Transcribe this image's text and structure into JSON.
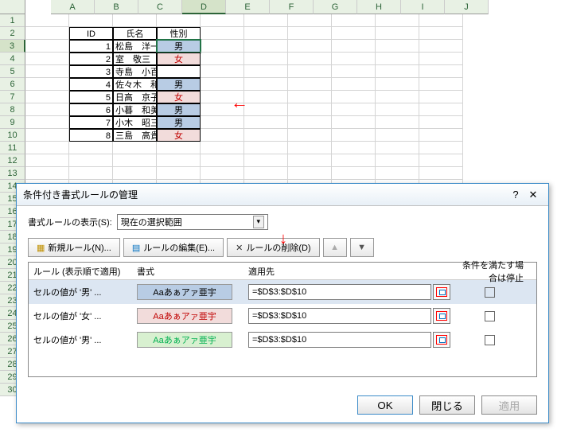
{
  "columns": [
    "A",
    "B",
    "C",
    "D",
    "E",
    "F",
    "G",
    "H",
    "I",
    "J"
  ],
  "table": {
    "headers": {
      "id": "ID",
      "name": "氏名",
      "sex": "性別"
    },
    "rows": [
      {
        "id": "1",
        "name": "松島　洋一朗",
        "sex": "男",
        "cls": "blue-bg"
      },
      {
        "id": "2",
        "name": "室　敬三",
        "sex": "女",
        "cls": "pink-bg"
      },
      {
        "id": "3",
        "name": "寺島　小百合",
        "sex": "",
        "cls": ""
      },
      {
        "id": "4",
        "name": "佐々木　和男",
        "sex": "男",
        "cls": "blue-bg"
      },
      {
        "id": "5",
        "name": "日高　京子",
        "sex": "女",
        "cls": "pink-bg"
      },
      {
        "id": "6",
        "name": "小暮　和美",
        "sex": "男",
        "cls": "blue-bg"
      },
      {
        "id": "7",
        "name": "小木　昭三",
        "sex": "男",
        "cls": "blue-bg"
      },
      {
        "id": "8",
        "name": "三島　高貴",
        "sex": "女",
        "cls": "pink-bg"
      }
    ]
  },
  "dialog": {
    "title": "条件付き書式ルールの管理",
    "showLabel": "書式ルールの表示(S):",
    "scope": "現在の選択範囲",
    "newRule": "新規ルール(N)...",
    "editRule": "ルールの編集(E)...",
    "delRule": "ルールの削除(D)",
    "colRule": "ルール (表示順で適用)",
    "colFormat": "書式",
    "colApply": "適用先",
    "colStop": "条件を満たす場合は停止",
    "rules": [
      {
        "label": "セルの値が '男' ...",
        "sample": "Aaあぁアァ亜宇",
        "cls": "bl",
        "ref": "=$D$3:$D$10"
      },
      {
        "label": "セルの値が '女' ...",
        "sample": "Aaあぁアァ亜宇",
        "cls": "pk",
        "ref": "=$D$3:$D$10"
      },
      {
        "label": "セルの値が '男' ...",
        "sample": "Aaあぁアァ亜宇",
        "cls": "gn",
        "ref": "=$D$3:$D$10"
      }
    ],
    "ok": "OK",
    "close": "閉じる",
    "apply": "適用"
  }
}
